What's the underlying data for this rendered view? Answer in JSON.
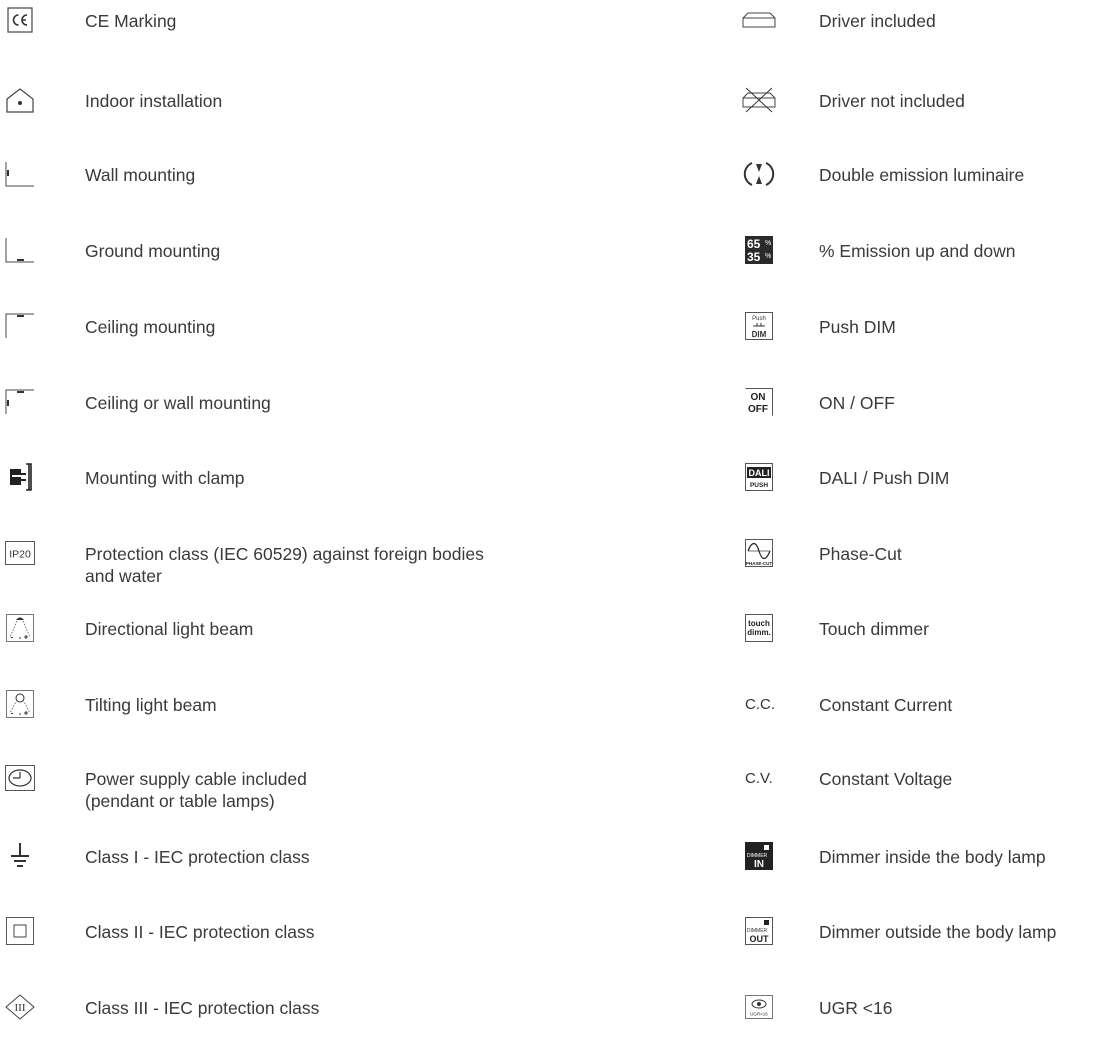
{
  "left_column": [
    {
      "icon": "ce-marking-icon",
      "label": "CE Marking"
    },
    {
      "icon": "indoor-installation-icon",
      "label": "Indoor installation"
    },
    {
      "icon": "wall-mounting-icon",
      "label": "Wall mounting"
    },
    {
      "icon": "ground-mounting-icon",
      "label": "Ground mounting"
    },
    {
      "icon": "ceiling-mounting-icon",
      "label": "Ceiling mounting"
    },
    {
      "icon": "ceiling-or-wall-mounting-icon",
      "label": "Ceiling or wall mounting"
    },
    {
      "icon": "clamp-mounting-icon",
      "label": "Mounting with clamp"
    },
    {
      "icon": "ip20-icon",
      "icon_text": "IP20",
      "label": "Protection class (IEC 60529) against foreign bodies",
      "label_line2": "and water"
    },
    {
      "icon": "directional-beam-icon",
      "label": "Directional light beam"
    },
    {
      "icon": "tilting-beam-icon",
      "label": "Tilting light beam"
    },
    {
      "icon": "power-cable-icon",
      "label": "Power supply cable included",
      "label_line2": "(pendant or table lamps)"
    },
    {
      "icon": "earth-ground-icon",
      "label": "Class I - IEC protection class"
    },
    {
      "icon": "class-ii-square-icon",
      "label": "Class II - IEC protection class"
    },
    {
      "icon": "class-iii-diamond-icon",
      "label": "Class III - IEC protection class"
    }
  ],
  "right_column": [
    {
      "icon": "driver-included-icon",
      "label": "Driver included"
    },
    {
      "icon": "driver-not-included-icon",
      "label": "Driver not included"
    },
    {
      "icon": "double-emission-icon",
      "label": "Double emission luminaire"
    },
    {
      "icon": "emission-percent-icon",
      "icon_text": [
        "65",
        "35"
      ],
      "label": "% Emission up and down"
    },
    {
      "icon": "push-dim-icon",
      "icon_text": [
        "Push",
        "DIM"
      ],
      "label": "Push DIM"
    },
    {
      "icon": "on-off-icon",
      "icon_text": [
        "ON",
        "OFF"
      ],
      "label": "ON / OFF"
    },
    {
      "icon": "dali-push-icon",
      "icon_text": [
        "DALI",
        "PUSH"
      ],
      "label": "DALI / Push DIM"
    },
    {
      "icon": "phase-cut-icon",
      "icon_text": "PHASE-CUT",
      "label": "Phase-Cut"
    },
    {
      "icon": "touch-dimmer-icon",
      "icon_text": [
        "touch",
        "dimm."
      ],
      "label": "Touch dimmer"
    },
    {
      "icon": "constant-current-icon",
      "icon_text": "C.C.",
      "label": "Constant Current"
    },
    {
      "icon": "constant-voltage-icon",
      "icon_text": "C.V.",
      "label": "Constant Voltage"
    },
    {
      "icon": "dimmer-in-icon",
      "icon_text": [
        "DIMMER",
        "IN"
      ],
      "label": "Dimmer inside the body lamp"
    },
    {
      "icon": "dimmer-out-icon",
      "icon_text": [
        "DIMMER",
        "OUT"
      ],
      "label": "Dimmer outside the body lamp"
    },
    {
      "icon": "ugr-icon",
      "icon_text": "UGR<16",
      "label": "UGR <16"
    }
  ]
}
